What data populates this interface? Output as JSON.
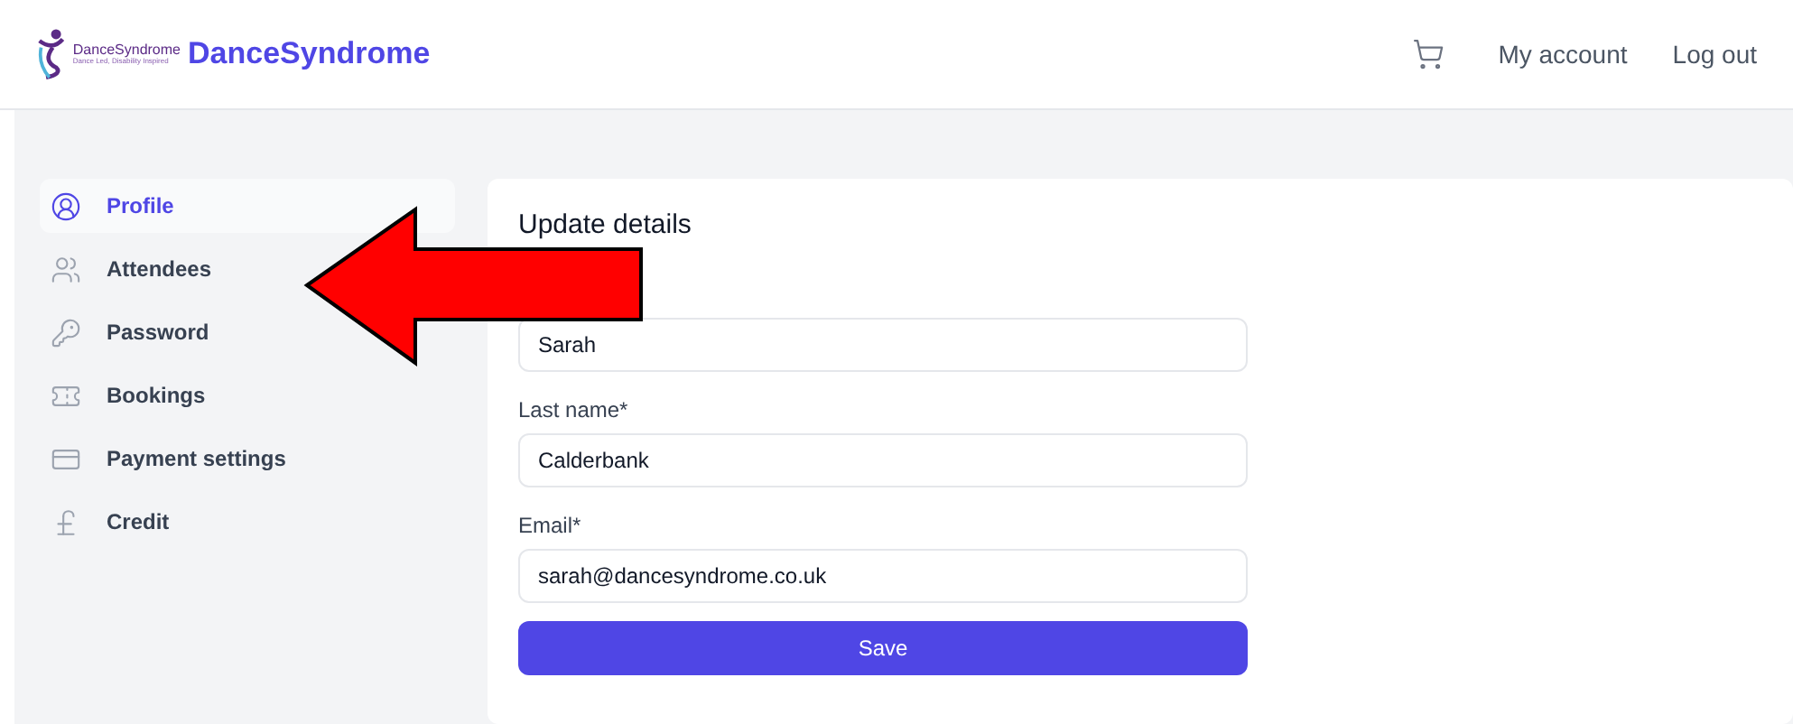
{
  "header": {
    "logo": {
      "name": "DanceSyndrome",
      "tagline": "Dance Led, Disability Inspired"
    },
    "brand": "DanceSyndrome",
    "links": [
      "My account",
      "Log out"
    ]
  },
  "sidebar": {
    "items": [
      {
        "label": "Profile",
        "selected": true
      },
      {
        "label": "Attendees",
        "selected": false
      },
      {
        "label": "Password",
        "selected": false
      },
      {
        "label": "Bookings",
        "selected": false
      },
      {
        "label": "Payment settings",
        "selected": false
      },
      {
        "label": "Credit",
        "selected": false
      }
    ]
  },
  "form": {
    "title": "Update details",
    "fields": [
      {
        "value": "Sarah"
      },
      {
        "label": "Last name*",
        "value": "Calderbank"
      },
      {
        "label": "Email*",
        "value": "sarah@dancesyndrome.co.uk"
      }
    ],
    "button": "Save"
  }
}
